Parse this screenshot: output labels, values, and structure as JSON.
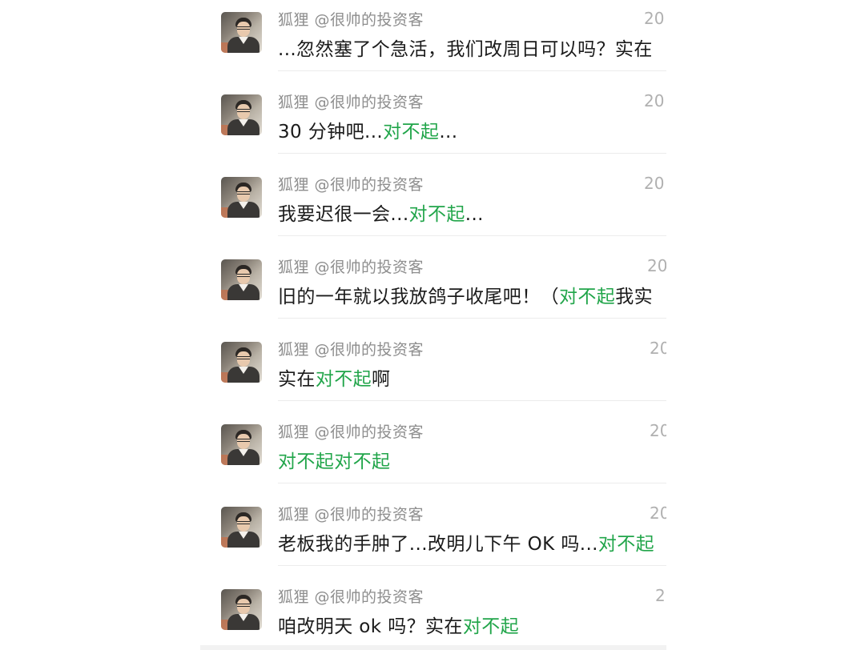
{
  "chat_list": {
    "items": [
      {
        "name": "狐狸 @很帅的投资客",
        "time": "20",
        "segments": [
          {
            "text": "...忽然塞了个急活，我们改周日可以吗？实在",
            "highlight": false
          }
        ]
      },
      {
        "name": "狐狸 @很帅的投资客",
        "time": "20",
        "segments": [
          {
            "text": "30 分钟吧...",
            "highlight": false
          },
          {
            "text": "对不起",
            "highlight": true
          },
          {
            "text": "...",
            "highlight": false
          }
        ]
      },
      {
        "name": "狐狸 @很帅的投资客",
        "time": "20",
        "segments": [
          {
            "text": "我要迟很一会...",
            "highlight": false
          },
          {
            "text": "对不起",
            "highlight": true
          },
          {
            "text": "...",
            "highlight": false
          }
        ]
      },
      {
        "name": "狐狸 @很帅的投资客",
        "time": "20",
        "segments": [
          {
            "text": "旧的一年就以我放鸽子收尾吧！（",
            "highlight": false
          },
          {
            "text": "对不起",
            "highlight": true
          },
          {
            "text": "我实",
            "highlight": false
          }
        ]
      },
      {
        "name": "狐狸 @很帅的投资客",
        "time": "20",
        "segments": [
          {
            "text": "实在",
            "highlight": false
          },
          {
            "text": "对不起",
            "highlight": true
          },
          {
            "text": "啊",
            "highlight": false
          }
        ]
      },
      {
        "name": "狐狸 @很帅的投资客",
        "time": "20",
        "segments": [
          {
            "text": "对不起对不起",
            "highlight": true
          }
        ]
      },
      {
        "name": "狐狸 @很帅的投资客",
        "time": "20",
        "segments": [
          {
            "text": "老板我的手肿了...改明儿下午 OK 吗...",
            "highlight": false
          },
          {
            "text": "对不起",
            "highlight": true
          }
        ]
      },
      {
        "name": "狐狸 @很帅的投资客",
        "time": "2",
        "segments": [
          {
            "text": "咱改明天 ok 吗？实在",
            "highlight": false
          },
          {
            "text": "对不起",
            "highlight": true
          }
        ]
      }
    ]
  },
  "colors": {
    "highlight": "#21a54a",
    "name_text": "#8e8e8e",
    "time_text": "#b0b0b0",
    "message_text": "#1b1b1b",
    "divider": "#ececec"
  }
}
